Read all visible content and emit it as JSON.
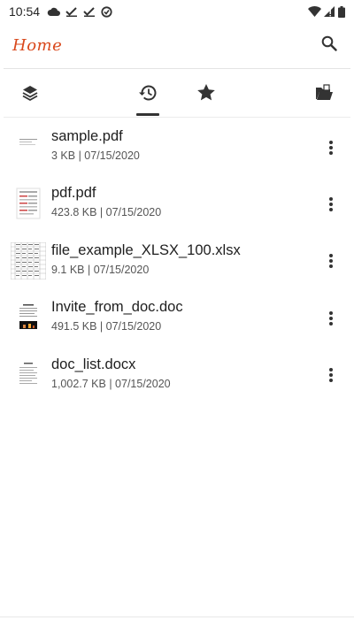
{
  "status_bar": {
    "time": "10:54",
    "left_icons": [
      "cloud-icon",
      "check-icon",
      "check-icon",
      "vpn-icon"
    ],
    "right_icons": [
      "wifi-icon",
      "signal-icon",
      "battery-icon"
    ]
  },
  "app_bar": {
    "title": "Home",
    "accent_color": "#d9481c",
    "search_icon": "search-icon"
  },
  "tabs": [
    {
      "icon": "layers-icon",
      "selected": false
    },
    {
      "icon": "history-icon",
      "selected": true
    },
    {
      "icon": "star-icon",
      "selected": false
    },
    {
      "icon": "folder-open-icon",
      "selected": false
    }
  ],
  "files": [
    {
      "name": "sample.pdf",
      "meta": "3 KB | 07/15/2020",
      "thumb": "pdf-thumbnail"
    },
    {
      "name": "pdf.pdf",
      "meta": "423.8 KB | 07/15/2020",
      "thumb": "pdf-thumbnail"
    },
    {
      "name": "file_example_XLSX_100.xlsx",
      "meta": "9.1 KB | 07/15/2020",
      "thumb": "spreadsheet-thumbnail"
    },
    {
      "name": "Invite_from_doc.doc",
      "meta": "491.5 KB | 07/15/2020",
      "thumb": "document-thumbnail"
    },
    {
      "name": "doc_list.docx",
      "meta": "1,002.7 KB | 07/15/2020",
      "thumb": "document-thumbnail"
    }
  ]
}
